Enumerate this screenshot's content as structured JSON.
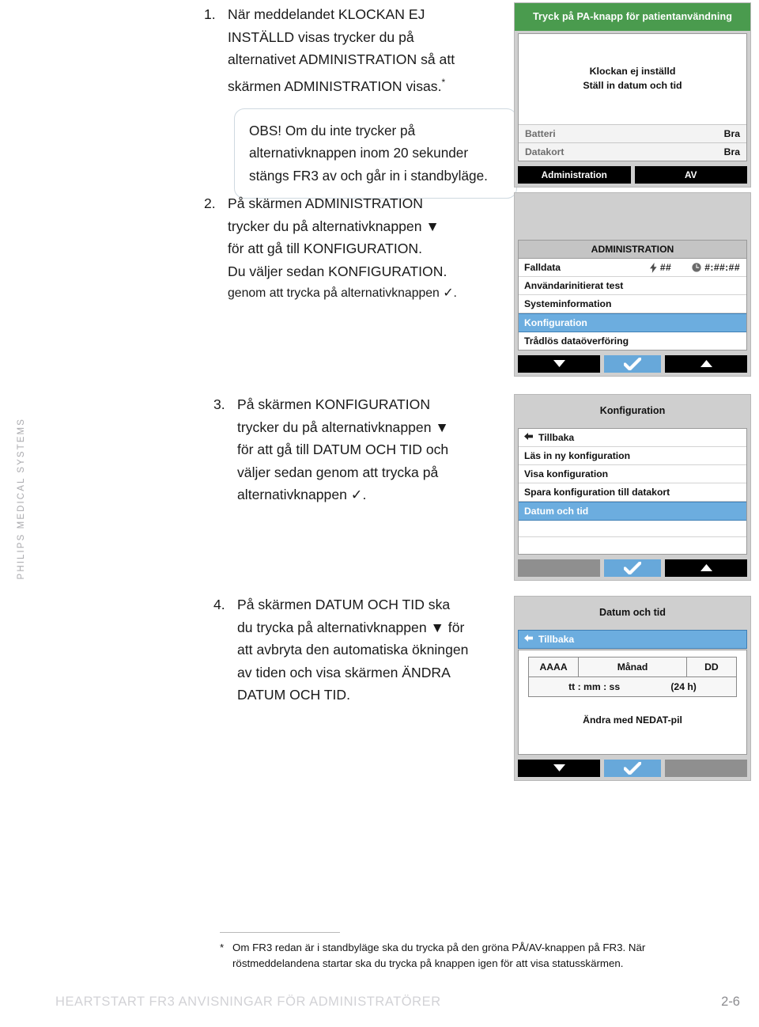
{
  "brand": {
    "vertical_text": "PHILIPS MEDICAL SYSTEMS"
  },
  "steps": [
    {
      "number": "1.",
      "lines": [
        "När meddelandet KLOCKAN EJ",
        "INSTÄLLD visas trycker du på",
        "alternativet ADMINISTRATION så att",
        "skärmen ADMINISTRATION visas."
      ],
      "asterisk": "*"
    },
    {
      "number": "2.",
      "lines": [
        "På skärmen ADMINISTRATION",
        "trycker du på alternativknappen ▼",
        "för att gå till KONFIGURATION.",
        "Du väljer sedan KONFIGURATION.",
        "genom att trycka på alternativknappen ✓."
      ]
    },
    {
      "number": "3.",
      "lines": [
        "På skärmen KONFIGURATION",
        "trycker du på alternativknappen ▼",
        "för att gå till DATUM OCH TID och",
        "väljer sedan genom att trycka på",
        "alternativknappen ✓."
      ]
    },
    {
      "number": "4.",
      "lines": [
        "På skärmen DATUM OCH TID ska",
        "du trycka på alternativknappen ▼ för",
        "att avbryta den automatiska ökningen",
        "av tiden och visa skärmen ÄNDRA",
        "DATUM OCH TID."
      ]
    }
  ],
  "note_box": {
    "lines": [
      "OBS! Om du inte trycker på",
      "alternativknappen inom 20 sekunder",
      "stängs FR3 av och går in i standbyläge."
    ]
  },
  "screens": {
    "status": {
      "header": "Tryck på PA-knapp för patientanvändning",
      "message_line1": "Klockan ej inställd",
      "message_line2": "Ställ in datum och tid",
      "status_rows": [
        {
          "label": "Batteri",
          "value": "Bra"
        },
        {
          "label": "Datakort",
          "value": "Bra"
        }
      ],
      "softkeys": [
        {
          "label": "Administration",
          "style": "black"
        },
        {
          "label": "AV",
          "style": "black"
        }
      ]
    },
    "administration": {
      "menu_title": "ADMINISTRATION",
      "items": [
        {
          "label": "Falldata",
          "selected": false,
          "battery_icon": "lightning-icon",
          "battery_value": "##",
          "clock_icon": "clock-icon",
          "clock_value": "#:##:##"
        },
        {
          "label": "Användarinitierat test",
          "selected": false
        },
        {
          "label": "Systeminformation",
          "selected": false
        },
        {
          "label": "Konfiguration",
          "selected": true
        },
        {
          "label": "Trådlös dataöverföring",
          "selected": false
        }
      ],
      "softkeys": [
        {
          "icon": "down-arrow-icon",
          "style": "black"
        },
        {
          "icon": "checkmark-icon",
          "style": "blue"
        },
        {
          "icon": "up-arrow-icon",
          "style": "black"
        }
      ]
    },
    "konfiguration": {
      "title": "Konfiguration",
      "items": [
        {
          "label": "Tillbaka",
          "back": true,
          "selected": false
        },
        {
          "label": "Läs in ny konfiguration",
          "selected": false
        },
        {
          "label": "Visa konfiguration",
          "selected": false
        },
        {
          "label": "Spara konfiguration till datakort",
          "selected": false
        },
        {
          "label": "Datum och tid",
          "selected": true
        },
        {
          "label": "",
          "selected": false
        },
        {
          "label": "",
          "selected": false
        }
      ],
      "softkeys": [
        {
          "icon": "",
          "style": "gray"
        },
        {
          "icon": "checkmark-icon",
          "style": "blue"
        },
        {
          "icon": "up-arrow-icon",
          "style": "black"
        }
      ]
    },
    "datum_och_tid": {
      "title": "Datum och tid",
      "back_label": "Tillbaka",
      "year_field": "AAAA",
      "month_field": "Månad",
      "day_field": "DD",
      "time_field": "tt : mm : ss",
      "hour_format": "(24 h)",
      "hint": "Ändra med NEDAT-pil",
      "softkeys": [
        {
          "icon": "down-arrow-icon",
          "style": "black"
        },
        {
          "icon": "checkmark-icon",
          "style": "blue"
        },
        {
          "icon": "",
          "style": "gray"
        }
      ]
    }
  },
  "footnote": {
    "mark": "*",
    "lines": [
      "Om FR3 redan är i standbyläge ska du trycka på den gröna PÅ/AV-knappen på FR3. När",
      "röstmeddelandena startar ska du trycka på knappen igen för att visa statusskärmen."
    ]
  },
  "footer": {
    "title": "HEARTSTART FR3 ANVISNINGAR FÖR ADMINISTRATÖRER",
    "page": "2-6"
  },
  "colors": {
    "green_header": "#4a9b4e",
    "blue_selection": "#6caddf",
    "device_bezel": "#cfcfcf"
  }
}
